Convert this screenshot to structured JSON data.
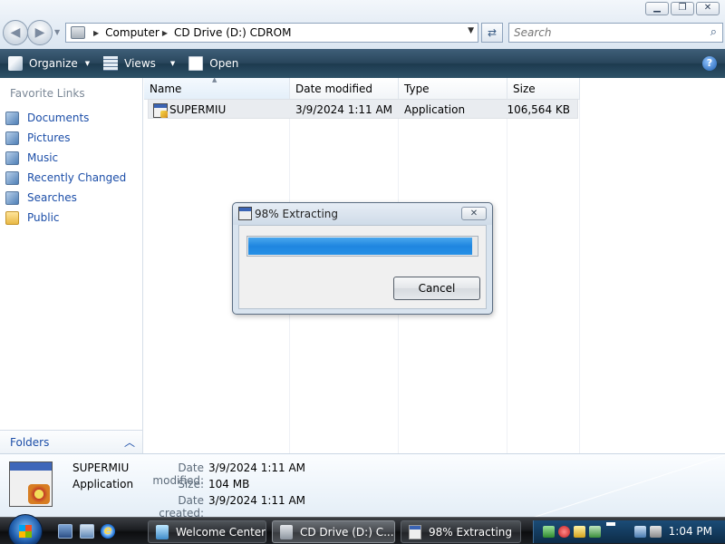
{
  "window": {
    "controls": {
      "minimize": "▁",
      "maximize": "❐",
      "close": "✕"
    }
  },
  "address_bar": {
    "breadcrumbs": [
      "Computer",
      "CD Drive (D:) CDROM"
    ],
    "search_placeholder": "Search"
  },
  "toolbar": {
    "organize_label": "Organize",
    "views_label": "Views",
    "open_label": "Open",
    "help_label": "?"
  },
  "sidebar": {
    "title": "Favorite Links",
    "items": [
      {
        "label": "Documents",
        "icon": "documents-icon"
      },
      {
        "label": "Pictures",
        "icon": "pictures-icon"
      },
      {
        "label": "Music",
        "icon": "music-icon"
      },
      {
        "label": "Recently Changed",
        "icon": "recently-changed-icon"
      },
      {
        "label": "Searches",
        "icon": "searches-icon"
      },
      {
        "label": "Public",
        "icon": "folder-icon"
      }
    ],
    "folders_label": "Folders"
  },
  "file_list": {
    "columns": [
      "Name",
      "Date modified",
      "Type",
      "Size"
    ],
    "rows": [
      {
        "name": "SUPERMIU",
        "date_modified": "3/9/2024 1:11 AM",
        "type": "Application",
        "size": "106,564 KB"
      }
    ]
  },
  "details_pane": {
    "name": "SUPERMIU",
    "type": "Application",
    "fields": [
      {
        "label": "Date modified:",
        "value": "3/9/2024 1:11 AM"
      },
      {
        "label": "Size:",
        "value": "104 MB"
      },
      {
        "label": "Date created:",
        "value": "3/9/2024 1:11 AM"
      }
    ]
  },
  "dialog": {
    "title": "98% Extracting",
    "progress": 0.98,
    "cancel_label": "Cancel",
    "close_label": "✕"
  },
  "taskbar": {
    "tasks": [
      {
        "label": "Welcome Center"
      },
      {
        "label": "CD Drive (D:) C..."
      },
      {
        "label": "98% Extracting"
      }
    ],
    "clock": "1:04 PM"
  }
}
